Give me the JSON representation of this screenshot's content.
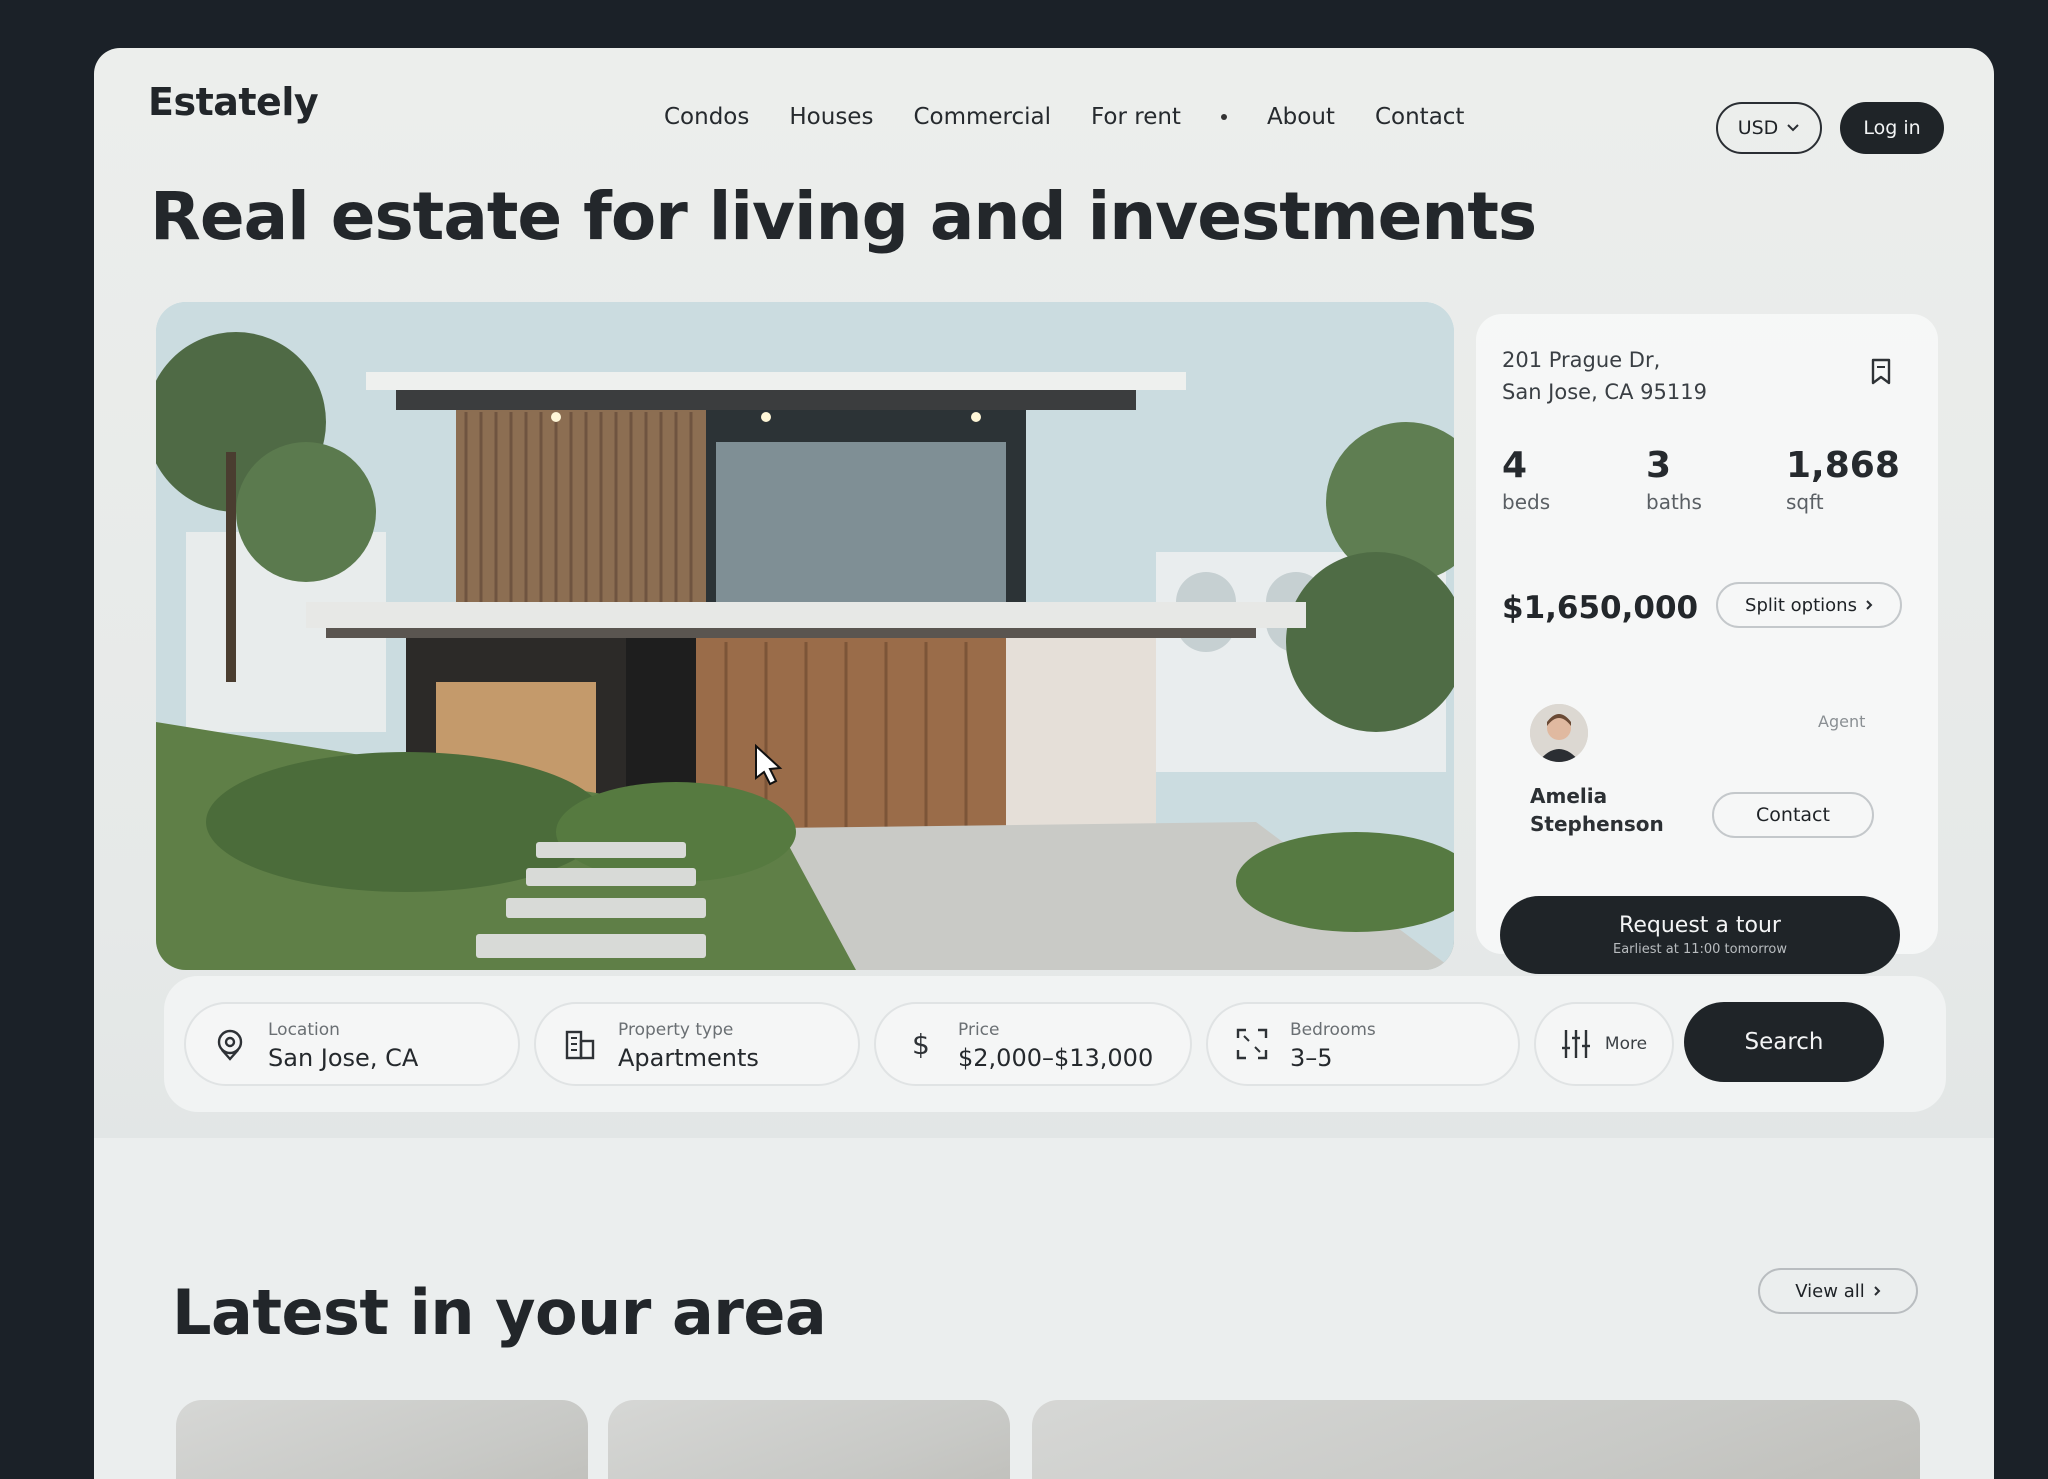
{
  "brand": {
    "logo": "Estately"
  },
  "nav": {
    "items": [
      "Condos",
      "Houses",
      "Commercial",
      "For rent",
      "About",
      "Contact"
    ],
    "currency": "USD",
    "login": "Log in"
  },
  "hero": {
    "headline": "Real estate for living and investments"
  },
  "listing": {
    "address_line1": "201 Prague Dr,",
    "address_line2": "San Jose, CA 95119",
    "beds": {
      "value": "4",
      "label": "beds"
    },
    "baths": {
      "value": "3",
      "label": "baths"
    },
    "sqft": {
      "value": "1,868",
      "label": "sqft"
    },
    "price": "$1,650,000",
    "split_options": "Split options",
    "agent": {
      "role": "Agent",
      "first_name": "Amelia",
      "last_name": "Stephenson",
      "contact": "Contact"
    },
    "tour": {
      "title": "Request a tour",
      "subtitle": "Earliest at 11:00 tomorrow"
    }
  },
  "search": {
    "location": {
      "label": "Location",
      "value": "San Jose, CA"
    },
    "property_type": {
      "label": "Property type",
      "value": "Apartments"
    },
    "price": {
      "label": "Price",
      "value": "$2,000–$13,000"
    },
    "bedrooms": {
      "label": "Bedrooms",
      "value": "3–5"
    },
    "more": "More",
    "button": "Search"
  },
  "latest": {
    "title": "Latest in your area",
    "view_all": "View all"
  },
  "icons": {
    "location": "map-pin-icon",
    "property_type": "building-icon",
    "price": "dollar-icon",
    "bedrooms": "expand-icon",
    "more": "sliders-icon",
    "bookmark": "bookmark-icon"
  }
}
